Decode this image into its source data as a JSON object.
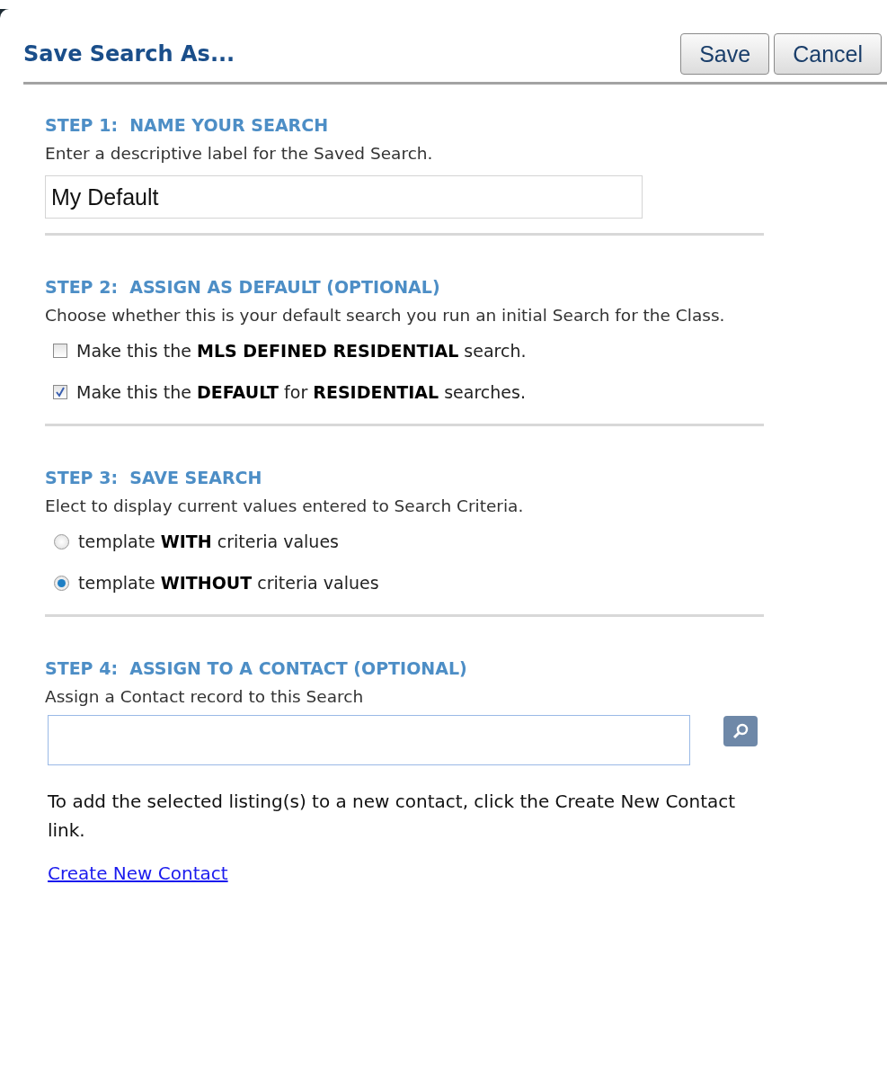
{
  "dialog": {
    "title": "Save Search As..."
  },
  "buttons": [
    {
      "label": "Save"
    },
    {
      "label": "Cancel"
    }
  ],
  "steps": [
    {
      "kind": "text_field",
      "heading": "STEP 1:  NAME YOUR SEARCH",
      "description": "Enter a descriptive label for the Saved Search.",
      "value": "My Default"
    },
    {
      "kind": "checkboxes",
      "heading": "STEP 2:  ASSIGN AS DEFAULT (OPTIONAL)",
      "description": "Choose whether this is your default search you run an initial Search for the Class.",
      "options": [
        {
          "label": "Make this the **MLS DEFINED RESIDENTIAL** search.",
          "checked": false
        },
        {
          "label": "Make this the **DEFAULT** for **RESIDENTIAL** searches.",
          "checked": true
        }
      ]
    },
    {
      "kind": "radios",
      "heading": "STEP 3:  SAVE SEARCH",
      "description": "Elect to display current values entered to Search Criteria.",
      "options": [
        {
          "label": "template **WITH** criteria values",
          "selected": false
        },
        {
          "label": "template **WITHOUT** criteria values",
          "selected": true
        }
      ]
    },
    {
      "kind": "lookup",
      "heading": "STEP 4:  ASSIGN TO A CONTACT (OPTIONAL)",
      "description": "Assign a Contact record to this Search",
      "note": "To add the selected listing(s) to a new contact, click the Create New Contact link.",
      "link": "Create New Contact"
    }
  ]
}
